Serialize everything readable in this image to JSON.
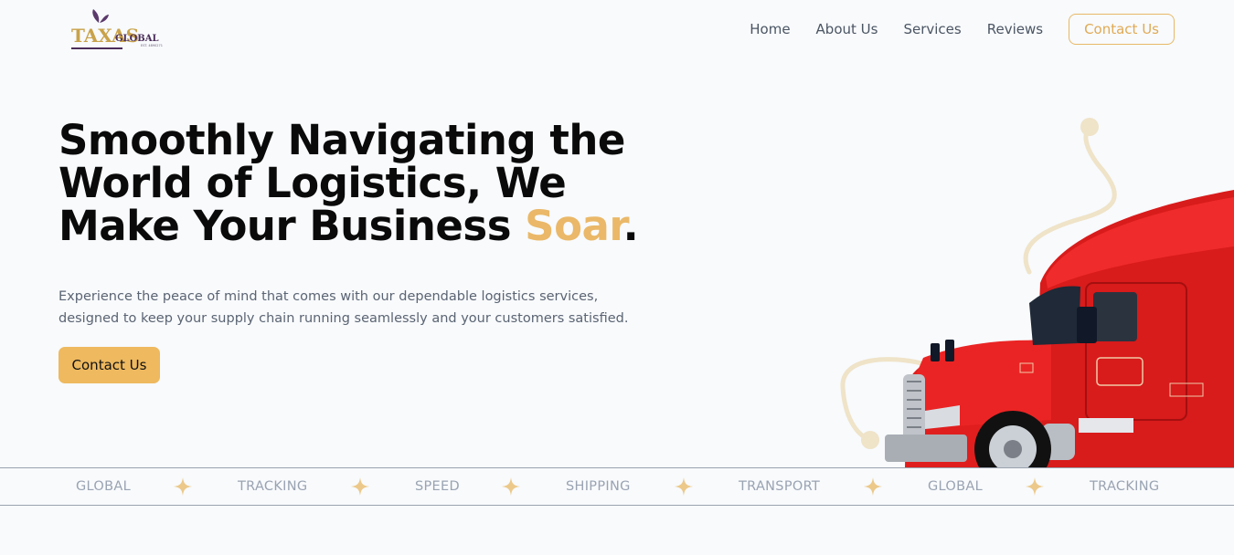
{
  "brand": {
    "name": "TAXAS",
    "name_suffix": "GLOBAL",
    "tagline": "EST. 4890271"
  },
  "nav": {
    "items": [
      "Home",
      "About Us",
      "Services",
      "Reviews"
    ],
    "cta": "Contact Us"
  },
  "hero": {
    "title_line1": "Smoothly Navigating the",
    "title_line2": "World of Logistics, We",
    "title_line3": "Make Your Business ",
    "title_accent": "Soar",
    "title_end": ".",
    "subtitle": "Experience the peace of mind that comes with our dependable logistics services, designed to keep your supply chain running seamlessly and your customers satisfied.",
    "button": "Contact Us"
  },
  "ticker": {
    "items": [
      "GLOBAL",
      "TRACKING",
      "SPEED",
      "SHIPPING",
      "TRANSPORT",
      "GLOBAL",
      "TRACKING"
    ],
    "separator_icon": "four-point-star-icon"
  },
  "colors": {
    "accent": "#eab868",
    "truck": "#e11d1d",
    "path": "#efe3c8",
    "text": "#0a0a0a"
  }
}
